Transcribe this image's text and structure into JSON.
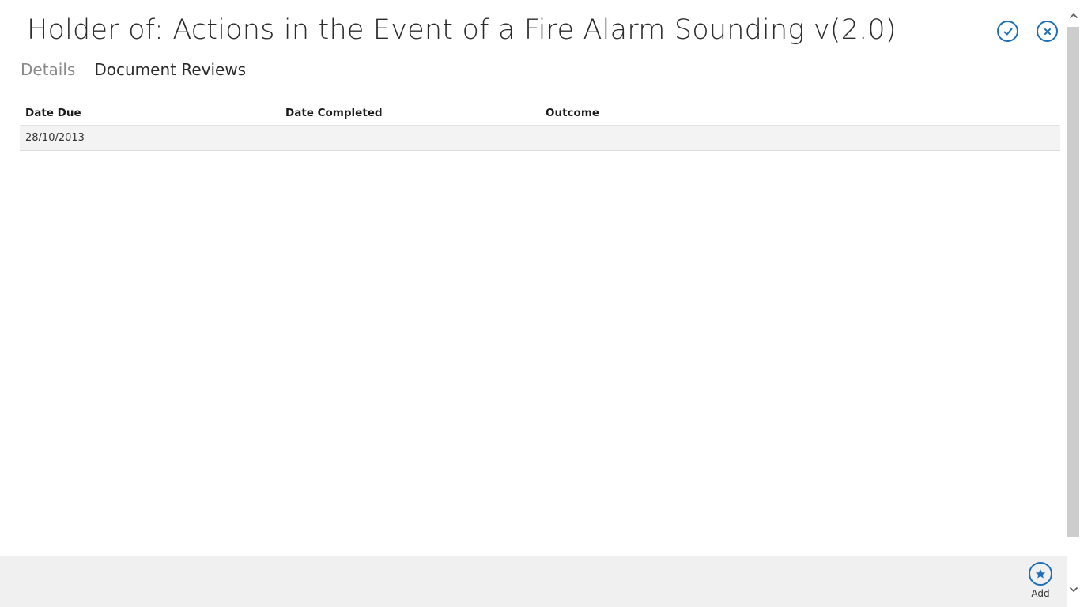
{
  "header": {
    "title": "Holder of: Actions in the Event of a Fire Alarm Sounding v(2.0)"
  },
  "tabs": [
    {
      "label": "Details",
      "active": false
    },
    {
      "label": "Document Reviews",
      "active": true
    }
  ],
  "grid": {
    "columns": [
      "Date Due",
      "Date Completed",
      "Outcome"
    ],
    "rows": [
      {
        "date_due": "28/10/2013",
        "date_completed": "",
        "outcome": ""
      }
    ]
  },
  "appbar": {
    "add_label": "Add"
  },
  "colors": {
    "accent": "#1e6fb5",
    "row_background": "#f3f3f3",
    "appbar_background": "#f0f0f0"
  },
  "icons": {
    "accept": "checkmark-circle-icon",
    "close": "close-circle-icon",
    "add": "star-circle-icon"
  }
}
